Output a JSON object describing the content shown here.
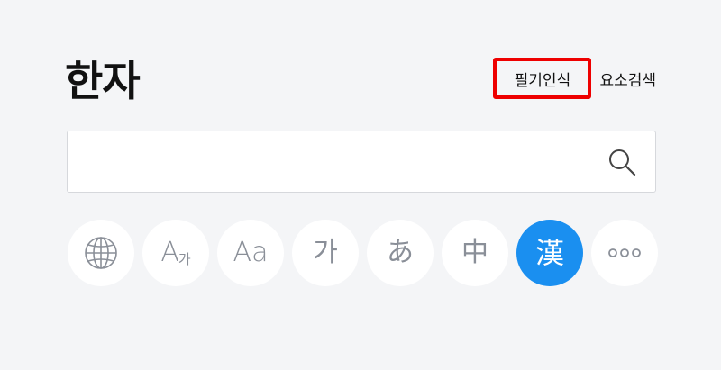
{
  "header": {
    "title": "한자",
    "handwriting_label": "필기인식",
    "radical_search_label": "요소검색"
  },
  "search": {
    "placeholder": "",
    "value": ""
  },
  "language_buttons": [
    {
      "icon": "globe-icon"
    },
    {
      "label_main": "A",
      "label_sub": "가"
    },
    {
      "label": "Aa"
    },
    {
      "label": "가"
    },
    {
      "label": "あ"
    },
    {
      "label": "中"
    },
    {
      "label": "漢",
      "active": true
    },
    {
      "icon": "more-icon"
    }
  ],
  "colors": {
    "background": "#f4f5f7",
    "highlight_border": "#ee0000",
    "active_button": "#1a8ff0",
    "icon_gray": "#8a8f98"
  }
}
